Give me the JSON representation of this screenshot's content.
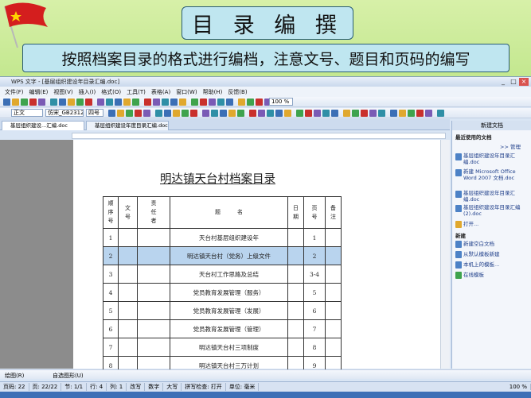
{
  "slide": {
    "title": "目 录 编 撰",
    "subtitle": "按照档案目录的格式进行编档，注意文号、题目和页码的编写"
  },
  "window": {
    "title": "WPS 文字 - [基层组织建设年目录汇编.doc]",
    "controls": [
      "_",
      "□",
      "×"
    ]
  },
  "menu": [
    "文件(F)",
    "编辑(E)",
    "视图(V)",
    "插入(I)",
    "格式(O)",
    "工具(T)",
    "表格(A)",
    "窗口(W)",
    "帮助(H)",
    "反馈(B)"
  ],
  "toolbar": {
    "zoom": "100 %",
    "style": "正文",
    "font": "仿宋_GB2312",
    "size": "四号"
  },
  "tabs": [
    "基层组织建设...汇编.doc",
    "基层组织建设年度目录汇编.doc"
  ],
  "document": {
    "heading": "明达镇天台村档案目录",
    "headers": [
      "顺序号",
      "文号",
      "责任者",
      "题　　　名",
      "日期",
      "页号",
      "备注"
    ],
    "rows": [
      {
        "no": "1",
        "title": "天台村基层组织建设年",
        "page": "1"
      },
      {
        "no": "2",
        "title": "明达镇天台村（党务）上级文件",
        "page": "2"
      },
      {
        "no": "3",
        "title": "天台村工作思路及总结",
        "page": "3-4"
      },
      {
        "no": "4",
        "title": "党员教育发展管理（服务）",
        "page": "5"
      },
      {
        "no": "5",
        "title": "党员教育发展管理（发展）",
        "page": "6"
      },
      {
        "no": "6",
        "title": "党员教育发展管理（管理）",
        "page": "7"
      },
      {
        "no": "7",
        "title": "明达镇天台村三项制度",
        "page": "8"
      },
      {
        "no": "8",
        "title": "明达镇天台村三万计划",
        "page": "9"
      }
    ],
    "selected_row": 2
  },
  "pane": {
    "title": "新建文档",
    "recent_heading": "最近使用的文档",
    "more": ">> 管理",
    "recent": [
      "基层组织建设年目录汇编.doc",
      "新建 Microsoft Office Word 2007 文档.doc",
      "基层组织建设年目录汇编.doc",
      "基层组织建设年目录汇编(2).doc",
      "打开..."
    ],
    "new_heading": "新建",
    "new_items": [
      "新建空白文档",
      "从默认模板新建",
      "本机上的模板...",
      "在线模板"
    ]
  },
  "status": {
    "page": "页码: 22",
    "pages": "页: 22/22",
    "section": "节: 1/1",
    "row": "行: 4",
    "col": "列: 1",
    "mode1": "改写",
    "mode2": "数字",
    "mode3": "大写",
    "spell": "拼写检查: 打开",
    "unit": "单位: 毫米",
    "zoom": "100 %"
  },
  "drawbar": {
    "draw": "绘图(R)",
    "autoshape": "自选图形(U)"
  }
}
